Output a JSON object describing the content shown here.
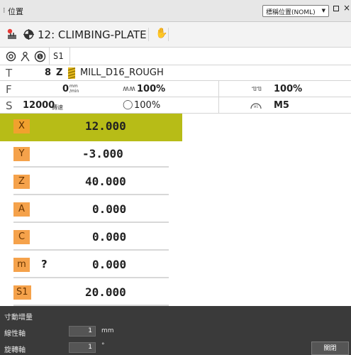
{
  "window": {
    "title": "位置",
    "view_selector": "標稱位置(NOML)"
  },
  "program": {
    "workpiece": "12: CLIMBING-PLATE"
  },
  "status_row": {
    "spindle_label": "S1"
  },
  "tool": {
    "label": "T",
    "number": "8",
    "axis": "Z",
    "name": "MILL_D16_ROUGH"
  },
  "feed": {
    "label": "F",
    "value": "0",
    "unit_top": "mm",
    "unit_bottom": "/min",
    "override": "100%",
    "rapid_override": "100%"
  },
  "spindle": {
    "label": "S",
    "value": "12000",
    "unit": "轉速",
    "override": "100%",
    "mfunction": "M5"
  },
  "axes": [
    {
      "name": "X",
      "value": "12.000",
      "active": true
    },
    {
      "name": "Y",
      "value": "-3.000",
      "active": false
    },
    {
      "name": "Z",
      "value": "40.000",
      "active": false
    },
    {
      "name": "A",
      "value": "0.000",
      "active": false
    },
    {
      "name": "C",
      "value": "0.000",
      "active": false
    },
    {
      "name": "m",
      "value": "0.000",
      "active": false,
      "marker": "?"
    },
    {
      "name": "S1",
      "value": "20.000",
      "active": false
    }
  ],
  "jog": {
    "title": "寸動增量",
    "linear_label": "線性軸",
    "linear_value": "1",
    "linear_unit": "mm",
    "rotary_label": "旋轉軸",
    "rotary_value": "1",
    "rotary_unit": "°",
    "close_label": "關閉"
  }
}
